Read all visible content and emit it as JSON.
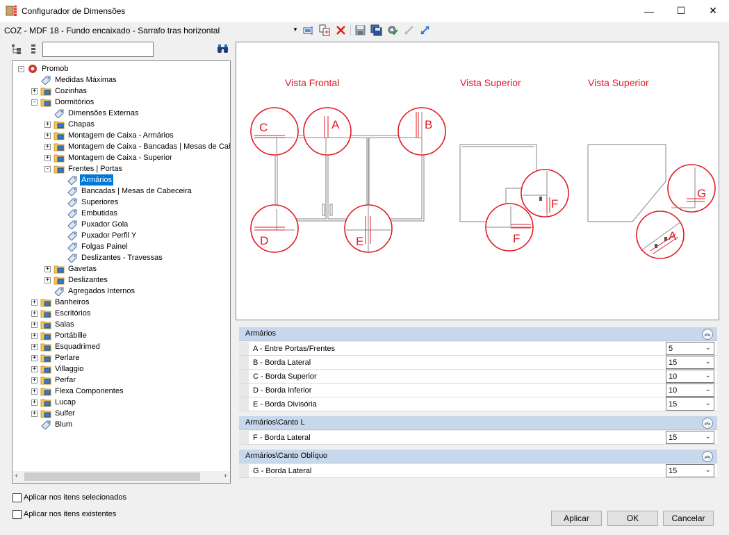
{
  "window": {
    "title": "Configurador de Dimensões",
    "minimize": "—",
    "maximize": "☐",
    "close": "✕"
  },
  "toolbar": {
    "combo_value": "COZ - MDF 18 - Fundo encaixado - Sarrafo tras horizontal"
  },
  "search": {
    "value": "",
    "placeholder": ""
  },
  "tree": [
    {
      "label": "Promob",
      "level": 0,
      "expander": "-",
      "icon": "promob-logo-icon"
    },
    {
      "label": "Medidas Máximas",
      "level": 1,
      "expander": "",
      "icon": "tag-icon"
    },
    {
      "label": "Cozinhas",
      "level": 1,
      "expander": "+",
      "icon": "folder-icon"
    },
    {
      "label": "Dormitórios",
      "level": 1,
      "expander": "-",
      "icon": "folder-icon"
    },
    {
      "label": "Dimensões Externas",
      "level": 2,
      "expander": "",
      "icon": "tag-icon"
    },
    {
      "label": "Chapas",
      "level": 2,
      "expander": "+",
      "icon": "folder-icon"
    },
    {
      "label": "Montagem de Caixa - Armários",
      "level": 2,
      "expander": "+",
      "icon": "folder-icon"
    },
    {
      "label": "Montagem de Caixa - Bancadas | Mesas de Cabeceira",
      "level": 2,
      "expander": "+",
      "icon": "folder-icon"
    },
    {
      "label": "Montagem de Caixa - Superior",
      "level": 2,
      "expander": "+",
      "icon": "folder-icon"
    },
    {
      "label": "Frentes | Portas",
      "level": 2,
      "expander": "-",
      "icon": "folder-icon"
    },
    {
      "label": "Armários",
      "level": 3,
      "expander": "",
      "icon": "tag-icon",
      "selected": true
    },
    {
      "label": "Bancadas | Mesas de Cabeceira",
      "level": 3,
      "expander": "",
      "icon": "tag-icon"
    },
    {
      "label": "Superiores",
      "level": 3,
      "expander": "",
      "icon": "tag-icon"
    },
    {
      "label": "Embutidas",
      "level": 3,
      "expander": "",
      "icon": "tag-icon"
    },
    {
      "label": "Puxador Gola",
      "level": 3,
      "expander": "",
      "icon": "tag-icon"
    },
    {
      "label": "Puxador Perfil Y",
      "level": 3,
      "expander": "",
      "icon": "tag-icon"
    },
    {
      "label": "Folgas Painel",
      "level": 3,
      "expander": "",
      "icon": "tag-icon"
    },
    {
      "label": "Deslizantes - Travessas",
      "level": 3,
      "expander": "",
      "icon": "tag-icon"
    },
    {
      "label": "Gavetas",
      "level": 2,
      "expander": "+",
      "icon": "folder-icon"
    },
    {
      "label": "Deslizantes",
      "level": 2,
      "expander": "+",
      "icon": "folder-icon"
    },
    {
      "label": "Agregados Internos",
      "level": 2,
      "expander": "",
      "icon": "tag-icon"
    },
    {
      "label": "Banheiros",
      "level": 1,
      "expander": "+",
      "icon": "folder-icon"
    },
    {
      "label": "Escritórios",
      "level": 1,
      "expander": "+",
      "icon": "folder-icon"
    },
    {
      "label": "Salas",
      "level": 1,
      "expander": "+",
      "icon": "folder-icon"
    },
    {
      "label": "Portábille",
      "level": 1,
      "expander": "+",
      "icon": "folder-icon"
    },
    {
      "label": "Esquadrimed",
      "level": 1,
      "expander": "+",
      "icon": "folder-icon"
    },
    {
      "label": "Perlare",
      "level": 1,
      "expander": "+",
      "icon": "folder-icon"
    },
    {
      "label": "Villaggio",
      "level": 1,
      "expander": "+",
      "icon": "folder-icon"
    },
    {
      "label": "Perfar",
      "level": 1,
      "expander": "+",
      "icon": "folder-icon"
    },
    {
      "label": "Flexa Componentes",
      "level": 1,
      "expander": "+",
      "icon": "folder-icon"
    },
    {
      "label": "Lucap",
      "level": 1,
      "expander": "+",
      "icon": "folder-icon"
    },
    {
      "label": "Sulfer",
      "level": 1,
      "expander": "+",
      "icon": "folder-icon"
    },
    {
      "label": "Blum",
      "level": 1,
      "expander": "",
      "icon": "tag-icon"
    }
  ],
  "preview": {
    "vista_frontal": "Vista Frontal",
    "vista_superior_1": "Vista Superior",
    "vista_superior_2": "Vista Superior",
    "labels": {
      "A": "A",
      "B": "B",
      "C": "C",
      "D": "D",
      "E": "E",
      "F": "F",
      "G": "G"
    },
    "accent": "#e01b24"
  },
  "groups": [
    {
      "title": "Armários",
      "props": [
        {
          "name": "A - Entre Portas/Frentes",
          "value": "5"
        },
        {
          "name": "B - Borda Lateral",
          "value": "15"
        },
        {
          "name": "C - Borda Superior",
          "value": "10"
        },
        {
          "name": "D - Borda Inferior",
          "value": "10"
        },
        {
          "name": "E - Borda Divisória",
          "value": "15"
        }
      ]
    },
    {
      "title": "Armários\\Canto L",
      "props": [
        {
          "name": "F - Borda Lateral",
          "value": "15"
        }
      ]
    },
    {
      "title": "Armários\\Canto Oblíquo",
      "props": [
        {
          "name": "G - Borda Lateral",
          "value": "15"
        }
      ]
    }
  ],
  "options": {
    "aplicar_selecionados": "Aplicar nos itens selecionados",
    "aplicar_existentes": "Aplicar nos itens existentes"
  },
  "buttons": {
    "aplicar": "Aplicar",
    "ok": "OK",
    "cancelar": "Cancelar"
  },
  "colors": {
    "selection": "#0078d7",
    "group_header": "#c7d8ec",
    "diagram_red": "#e01b24"
  }
}
